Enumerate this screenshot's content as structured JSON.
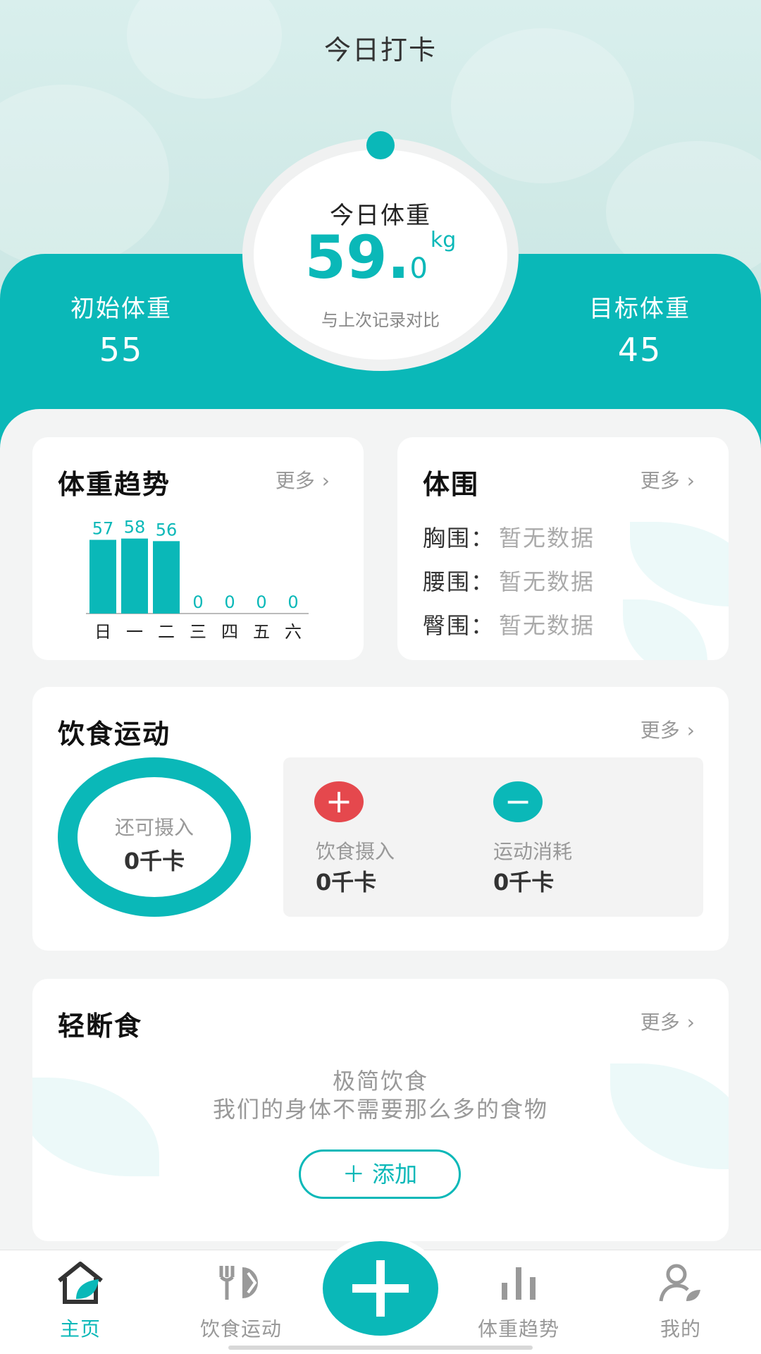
{
  "header": {
    "title": "今日打卡"
  },
  "weight": {
    "today_label": "今日体重",
    "today_int": "59.",
    "today_dec": "0",
    "unit": "kg",
    "compare_label": "与上次记录对比",
    "initial_label": "初始体重",
    "initial_value": "55",
    "target_label": "目标体重",
    "target_value": "45"
  },
  "trend_card": {
    "title": "体重趋势",
    "more": "更多"
  },
  "chart_data": {
    "type": "bar",
    "categories": [
      "日",
      "一",
      "二",
      "三",
      "四",
      "五",
      "六"
    ],
    "values": [
      57,
      58,
      56,
      0,
      0,
      0,
      0
    ],
    "ylim": [
      0,
      60
    ],
    "color": "#0ab8b8",
    "grid": false,
    "legend": "none"
  },
  "girth_card": {
    "title": "体围",
    "more": "更多",
    "rows": [
      {
        "label": "胸围：",
        "value": "暂无数据"
      },
      {
        "label": "腰围：",
        "value": "暂无数据"
      },
      {
        "label": "臀围：",
        "value": "暂无数据"
      }
    ]
  },
  "diet_card": {
    "title": "饮食运动",
    "more": "更多",
    "remaining_label": "还可摄入",
    "remaining_value": "0千卡",
    "intake_label": "饮食摄入",
    "intake_value": "0千卡",
    "burn_label": "运动消耗",
    "burn_value": "0千卡",
    "plus_color": "#e5484d",
    "minus_color": "#0ab8b8"
  },
  "fasting_card": {
    "title": "轻断食",
    "more": "更多",
    "line1": "极简饮食",
    "line2": "我们的身体不需要那么多的食物",
    "add_label": "添加",
    "add_icon": "plus-icon"
  },
  "tabbar": {
    "items": [
      {
        "label": "主页",
        "icon": "home-icon"
      },
      {
        "label": "饮食运动",
        "icon": "utensils-icon"
      },
      {
        "label": "体重趋势",
        "icon": "bar-chart-icon"
      },
      {
        "label": "我的",
        "icon": "user-icon"
      }
    ],
    "fab_icon": "plus-icon"
  }
}
